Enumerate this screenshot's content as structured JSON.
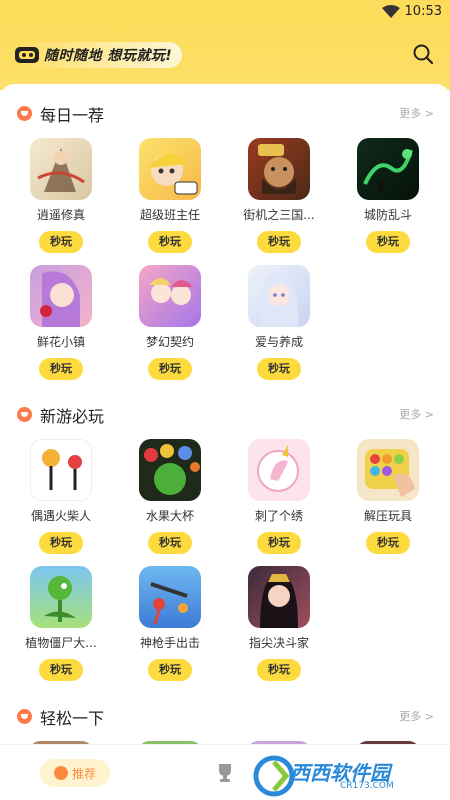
{
  "status_bar": {
    "time": "10:53"
  },
  "header": {
    "slogan": "随时随地 想玩就玩!"
  },
  "sections": [
    {
      "title": "每日一荐",
      "more": "更多 >",
      "games": [
        {
          "name": "逍遥修真",
          "play": "秒玩"
        },
        {
          "name": "超级班主任",
          "play": "秒玩"
        },
        {
          "name": "街机之三国...",
          "play": "秒玩"
        },
        {
          "name": "城防乱斗",
          "play": "秒玩"
        },
        {
          "name": "鲜花小镇",
          "play": "秒玩"
        },
        {
          "name": "梦幻契约",
          "play": "秒玩"
        },
        {
          "name": "爱与养成",
          "play": "秒玩"
        }
      ]
    },
    {
      "title": "新游必玩",
      "more": "更多 >",
      "games": [
        {
          "name": "偶遇火柴人",
          "play": "秒玩"
        },
        {
          "name": "水果大杯",
          "play": "秒玩"
        },
        {
          "name": "刺了个绣",
          "play": "秒玩"
        },
        {
          "name": "解压玩具",
          "play": "秒玩"
        },
        {
          "name": "植物僵尸大...",
          "play": "秒玩"
        },
        {
          "name": "神枪手出击",
          "play": "秒玩"
        },
        {
          "name": "指尖决斗家",
          "play": "秒玩"
        }
      ]
    },
    {
      "title": "轻松一下",
      "more": "更多 >"
    }
  ],
  "tab_bar": {
    "recommend": "推荐"
  },
  "watermark": {
    "main": "西西软件园",
    "sub": "CR173.COM"
  },
  "colors": {
    "accent": "#fddb3e",
    "header": "#fddc5c",
    "section_dot": "#ff7a4a"
  }
}
